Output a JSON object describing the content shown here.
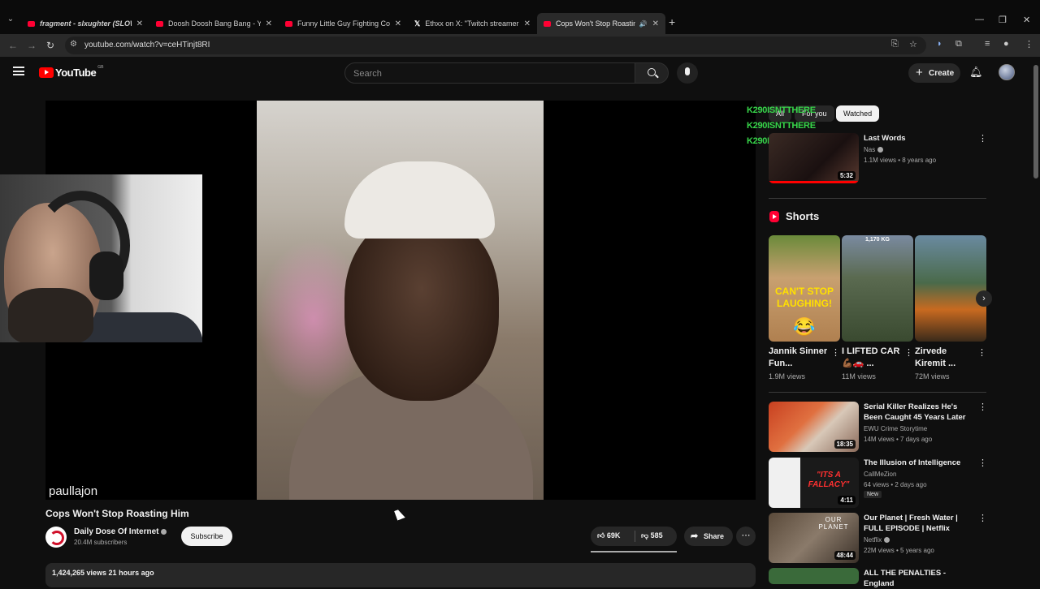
{
  "browser": {
    "tabs": [
      {
        "title": "fragment - slxughter (SLOW",
        "italic": true,
        "favicon": "youtube"
      },
      {
        "title": "Doosh Doosh Bang Bang - You",
        "italic": false,
        "favicon": "youtube"
      },
      {
        "title": "Funny Little Guy Fighting Comp",
        "italic": false,
        "favicon": "youtube"
      },
      {
        "title": "Ethxx on X: \"Twitch streamer Fi",
        "italic": false,
        "favicon": "x"
      },
      {
        "title": "Cops Won't Stop Roasting I",
        "italic": false,
        "favicon": "youtube",
        "active": true
      }
    ],
    "url": "youtube.com/watch?v=ceHTinjt8RI"
  },
  "header": {
    "logo_text": "YouTube",
    "region": "GB",
    "search_placeholder": "Search",
    "create_label": "Create"
  },
  "player": {
    "streamer_name": "paullajon",
    "overlay_lines": [
      "K290ISNTTHERE",
      "K290ISNTTHERE",
      "K290ISNTTHERE"
    ]
  },
  "video": {
    "title": "Cops Won't Stop Roasting Him",
    "channel": "Daily Dose Of Internet",
    "subscribers": "20.4M subscribers",
    "subscribe_label": "Subscribe",
    "likes": "69K",
    "dislikes": "585",
    "share_label": "Share",
    "views_time": "1,424,265 views  21 hours ago"
  },
  "sidebar": {
    "chips": [
      "All",
      "For you",
      "Watched"
    ],
    "top_rec": {
      "title": "Last Words",
      "channel": "Nas",
      "meta": "1.1M views • 8 years ago",
      "duration": "5:32"
    },
    "shorts_title": "Shorts",
    "shorts": [
      {
        "title": "Jannik Sinner Fun...",
        "views": "1.9M views",
        "thumb_text": "CAN'T STOP LAUGHING!"
      },
      {
        "title": "I LIFTED CAR 💪🏾🚗 ...",
        "views": "11M views",
        "thumb_text": "1,170 KG"
      },
      {
        "title": "Zirvede Kiremit ...",
        "views": "72M views",
        "thumb_text": ""
      }
    ],
    "recs": [
      {
        "title": "Serial Killer Realizes He's Been Caught 45 Years Later",
        "channel": "EWU Crime Storytime",
        "meta": "14M views • 7 days ago",
        "duration": "18:35",
        "badge": ""
      },
      {
        "title": "The Illusion of Intelligence",
        "channel": "CallMeZion",
        "meta": "64 views • 2 days ago",
        "duration": "4:11",
        "badge": "New",
        "thumb_text": "\"ITS A FALLACY\""
      },
      {
        "title": "Our Planet | Fresh Water | FULL EPISODE | Netflix",
        "channel": "Netflix",
        "meta": "22M views • 5 years ago",
        "duration": "48:44",
        "badge": "",
        "thumb_text": "OUR PLANET"
      },
      {
        "title": "ALL THE PENALTIES - England",
        "channel": "",
        "meta": "",
        "duration": "",
        "badge": ""
      }
    ]
  }
}
